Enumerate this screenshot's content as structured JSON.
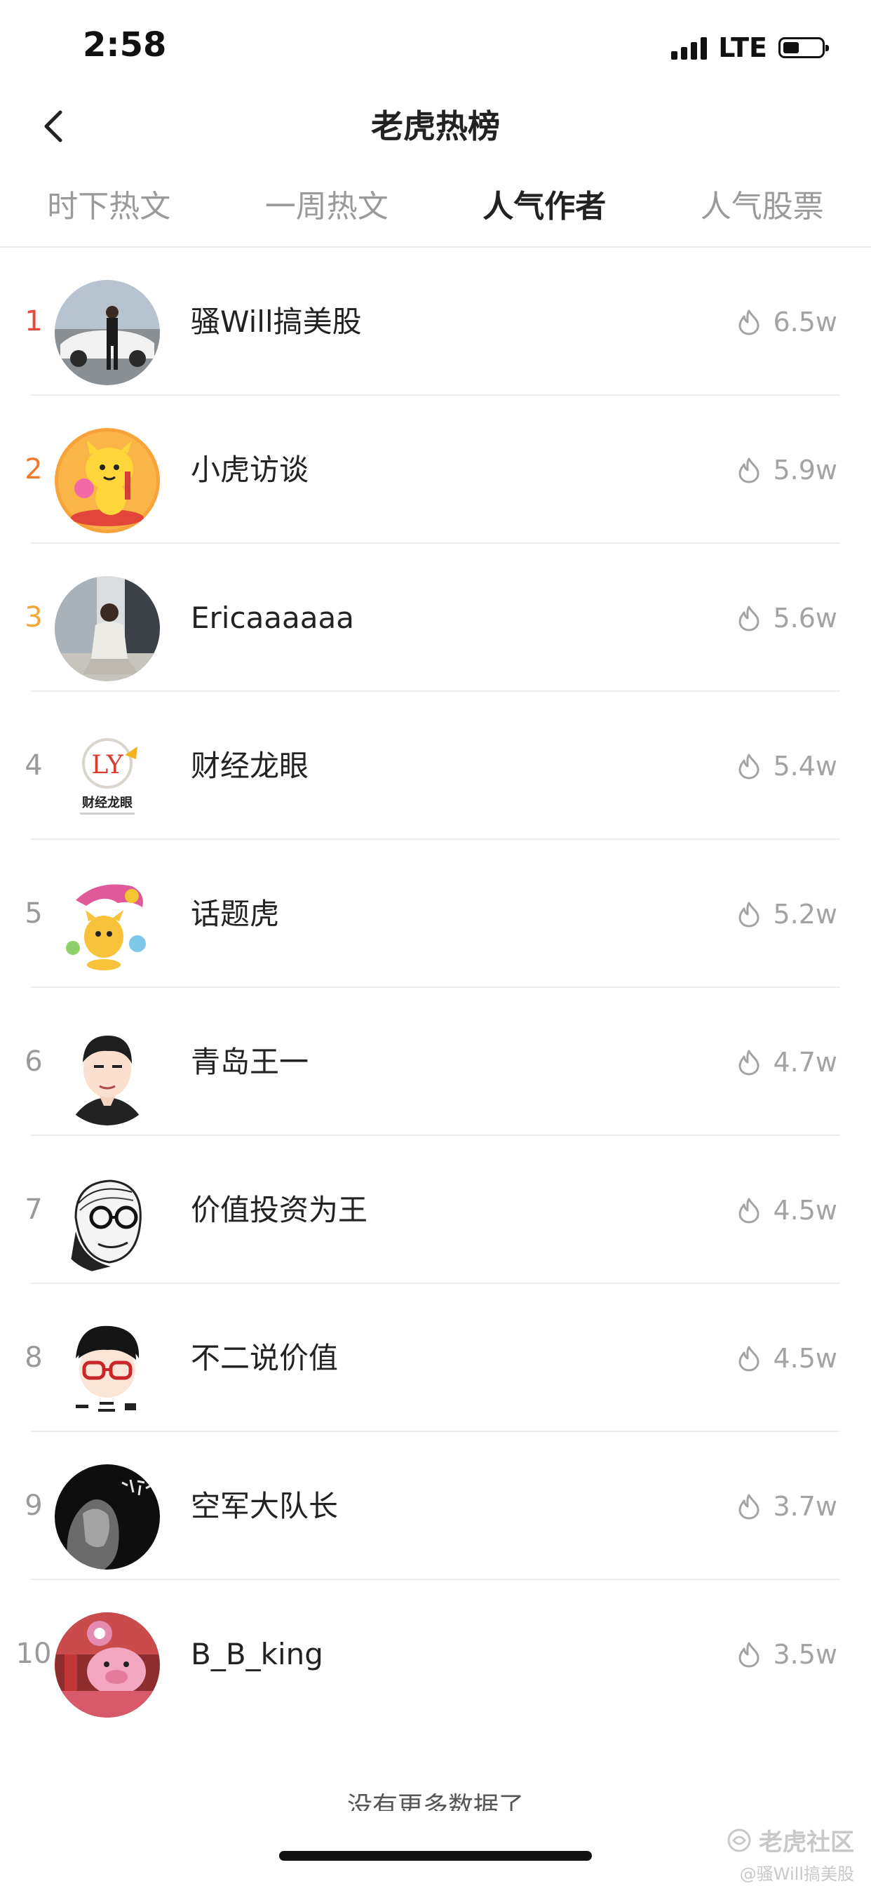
{
  "status_bar": {
    "time": "2:58",
    "network": "LTE"
  },
  "nav": {
    "title": "老虎热榜"
  },
  "tabs": [
    {
      "label": "时下热文",
      "active": false
    },
    {
      "label": "一周热文",
      "active": false
    },
    {
      "label": "人气作者",
      "active": true
    },
    {
      "label": "人气股票",
      "active": false
    }
  ],
  "authors": [
    {
      "rank": "1",
      "name": "骚Will搞美股",
      "heat": "6.5w",
      "rank_color": "#e4493c"
    },
    {
      "rank": "2",
      "name": "小虎访谈",
      "heat": "5.9w",
      "rank_color": "#f07a2c"
    },
    {
      "rank": "3",
      "name": "Ericaaaaaa",
      "heat": "5.6w",
      "rank_color": "#f2a635"
    },
    {
      "rank": "4",
      "name": "财经龙眼",
      "heat": "5.4w",
      "rank_color": "#9a9a9a"
    },
    {
      "rank": "5",
      "name": "话题虎",
      "heat": "5.2w",
      "rank_color": "#9a9a9a"
    },
    {
      "rank": "6",
      "name": "青岛王一",
      "heat": "4.7w",
      "rank_color": "#9a9a9a"
    },
    {
      "rank": "7",
      "name": "价值投资为王",
      "heat": "4.5w",
      "rank_color": "#9a9a9a"
    },
    {
      "rank": "8",
      "name": "不二说价值",
      "heat": "4.5w",
      "rank_color": "#9a9a9a"
    },
    {
      "rank": "9",
      "name": "空军大队长",
      "heat": "3.7w",
      "rank_color": "#9a9a9a"
    },
    {
      "rank": "10",
      "name": "B_B_king",
      "heat": "3.5w",
      "rank_color": "#9a9a9a"
    }
  ],
  "footer": {
    "end_text": "没有更多数据了"
  },
  "watermark": {
    "brand": "老虎社区",
    "user": "@骚Will搞美股"
  },
  "avatar_logo_text": {
    "letters": "LY",
    "caption": "财经龙眼"
  }
}
